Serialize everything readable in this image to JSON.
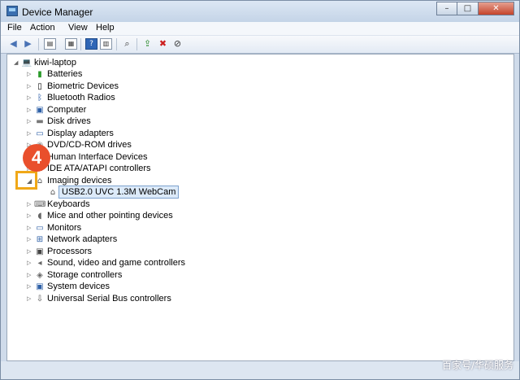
{
  "window": {
    "title": "Device Manager",
    "controls": {
      "minimize": "–",
      "maximize": "□",
      "close": "✕"
    }
  },
  "menu": [
    "File",
    "Action",
    "View",
    "Help"
  ],
  "toolbar": {
    "icons": [
      "back-icon",
      "forward-icon",
      "properties-icon",
      "help-icon",
      "scan-icon",
      "update-driver-icon",
      "uninstall-icon",
      "disable-icon"
    ]
  },
  "tree": {
    "root": "kiwi-laptop",
    "items": [
      {
        "label": "Batteries",
        "icon": "battery-icon",
        "expanded": false
      },
      {
        "label": "Biometric Devices",
        "icon": "fingerprint-icon",
        "expanded": false
      },
      {
        "label": "Bluetooth Radios",
        "icon": "bluetooth-icon",
        "expanded": false
      },
      {
        "label": "Computer",
        "icon": "computer-icon",
        "expanded": false
      },
      {
        "label": "Disk drives",
        "icon": "disk-icon",
        "expanded": false
      },
      {
        "label": "Display adapters",
        "icon": "display-icon",
        "expanded": false
      },
      {
        "label": "DVD/CD-ROM drives",
        "icon": "dvd-icon",
        "expanded": false
      },
      {
        "label": "Human Interface Devices",
        "icon": "hid-icon",
        "expanded": false
      },
      {
        "label": "IDE ATA/ATAPI controllers",
        "icon": "ide-icon",
        "expanded": false
      },
      {
        "label": "Imaging devices",
        "icon": "camera-icon",
        "expanded": true,
        "children": [
          {
            "label": "USB2.0 UVC 1.3M WebCam",
            "icon": "webcam-icon",
            "selected": true
          }
        ]
      },
      {
        "label": "Keyboards",
        "icon": "keyboard-icon",
        "expanded": false
      },
      {
        "label": "Mice and other pointing devices",
        "icon": "mouse-icon",
        "expanded": false
      },
      {
        "label": "Monitors",
        "icon": "monitor-icon",
        "expanded": false
      },
      {
        "label": "Network adapters",
        "icon": "network-icon",
        "expanded": false
      },
      {
        "label": "Processors",
        "icon": "processor-icon",
        "expanded": false
      },
      {
        "label": "Sound, video and game controllers",
        "icon": "sound-icon",
        "expanded": false
      },
      {
        "label": "Storage controllers",
        "icon": "storage-icon",
        "expanded": false
      },
      {
        "label": "System devices",
        "icon": "system-icon",
        "expanded": false
      },
      {
        "label": "Universal Serial Bus controllers",
        "icon": "usb-icon",
        "expanded": false
      }
    ]
  },
  "annotation": {
    "step_number": "4"
  },
  "watermark": "百家号/华硕服务",
  "colors": {
    "callout": "#e94f2c",
    "highlight": "#f0a818",
    "selection": "#dceaf9"
  }
}
